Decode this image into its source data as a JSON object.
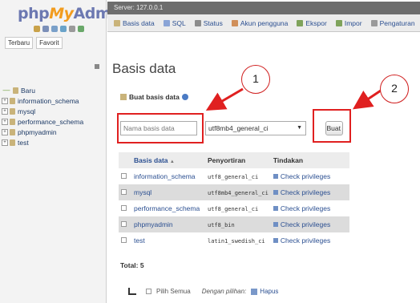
{
  "left_panel": {
    "logo": {
      "part1": "php",
      "part2": "My",
      "part3": "Admin"
    },
    "tabs": [
      "Terbaru",
      "Favorit"
    ],
    "tree": [
      {
        "label": "Baru",
        "new": true
      },
      {
        "label": "information_schema"
      },
      {
        "label": "mysql"
      },
      {
        "label": "performance_schema"
      },
      {
        "label": "phpmyadmin"
      },
      {
        "label": "test"
      }
    ]
  },
  "server_bar": {
    "label": "Server: 127.0.0.1"
  },
  "nav_tabs": [
    {
      "label": "Basis data",
      "icon": "database-icon",
      "color": "#c9b37a"
    },
    {
      "label": "SQL",
      "icon": "sql-icon",
      "color": "#8aa4d6"
    },
    {
      "label": "Status",
      "icon": "status-icon",
      "color": "#8c8c8c"
    },
    {
      "label": "Akun pengguna",
      "icon": "user-accounts-icon",
      "color": "#d08f5a"
    },
    {
      "label": "Ekspor",
      "icon": "export-icon",
      "color": "#7fa35b"
    },
    {
      "label": "Impor",
      "icon": "import-icon",
      "color": "#7fa35b"
    },
    {
      "label": "Pengaturan",
      "icon": "wrench-icon",
      "color": "#9a9a9a"
    }
  ],
  "main": {
    "title": "Basis data",
    "create_label": "Buat basis data",
    "db_name_placeholder": "Nama basis data",
    "collation_value": "utf8mb4_general_ci",
    "create_button": "Buat"
  },
  "annotations": {
    "circle1": "1",
    "circle2": "2",
    "color": "#e02020"
  },
  "table": {
    "headers": [
      "Basis data",
      "Penyortiran",
      "Tindakan"
    ],
    "sort_indicator": "▲",
    "rows": [
      {
        "name": "information_schema",
        "collation": "utf8_general_ci",
        "action": "Check privileges"
      },
      {
        "name": "mysql",
        "collation": "utf8mb4_general_ci",
        "action": "Check privileges"
      },
      {
        "name": "performance_schema",
        "collation": "utf8_general_ci",
        "action": "Check privileges"
      },
      {
        "name": "phpmyadmin",
        "collation": "utf8_bin",
        "action": "Check privileges"
      },
      {
        "name": "test",
        "collation": "latin1_swedish_ci",
        "action": "Check privileges"
      }
    ],
    "total": "Total: 5"
  },
  "footer": {
    "check_all": "Pilih Semua",
    "with_selected": "Dengan pilihan:",
    "delete": "Hapus"
  }
}
